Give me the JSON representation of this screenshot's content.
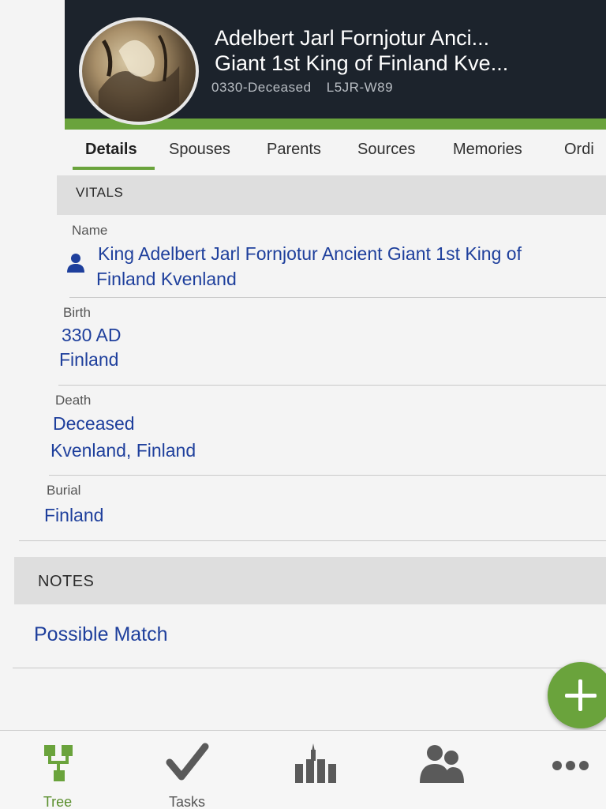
{
  "person": {
    "title_line1": "Adelbert Jarl Fornjotur Anci...",
    "title_line2": "Giant 1st King of Finland Kve...",
    "lifespan": "0330-Deceased",
    "pid": "L5JR-W89"
  },
  "tabs": [
    {
      "label": "Details",
      "active": true
    },
    {
      "label": "Spouses"
    },
    {
      "label": "Parents"
    },
    {
      "label": "Sources"
    },
    {
      "label": "Memories"
    },
    {
      "label": "Ordi"
    }
  ],
  "vitals": {
    "header": "VITALS",
    "name_label": "Name",
    "name_line1": "King Adelbert Jarl Fornjotur Ancient Giant 1st King of",
    "name_line2": "Finland Kvenland",
    "birth_label": "Birth",
    "birth_date": "330 AD",
    "birth_place": "Finland",
    "death_label": "Death",
    "death_date": "Deceased",
    "death_place": "Kvenland, Finland",
    "burial_label": "Burial",
    "burial_place": "Finland"
  },
  "notes": {
    "header": "NOTES",
    "item": "Possible Match"
  },
  "bottom_nav": [
    {
      "label": "Tree",
      "icon": "tree-icon",
      "active": true
    },
    {
      "label": "Tasks",
      "icon": "checkmark-icon"
    },
    {
      "label": "",
      "icon": "temple-icon"
    },
    {
      "label": "",
      "icon": "people-icon"
    },
    {
      "label": "",
      "icon": "more-icon"
    }
  ],
  "colors": {
    "header_bg": "#1c232c",
    "accent_green": "#6aa33c",
    "link_blue": "#1e3f9c"
  }
}
